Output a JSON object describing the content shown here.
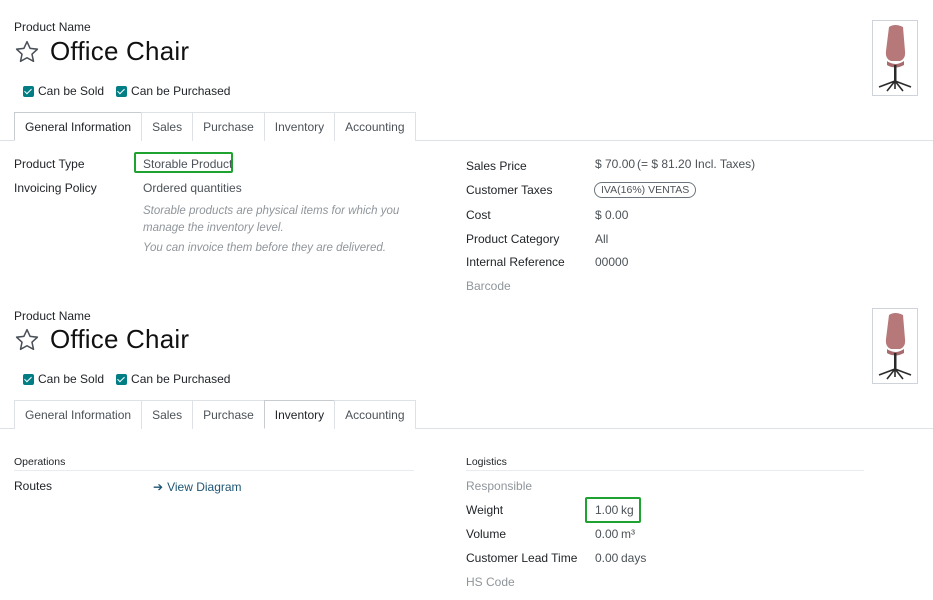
{
  "panels": [
    {
      "product_name_label": "Product Name",
      "title": "Office Chair",
      "checks": [
        "Can be Sold",
        "Can be Purchased"
      ],
      "tabs": [
        "General Information",
        "Sales",
        "Purchase",
        "Inventory",
        "Accounting"
      ],
      "active_tab": "General Information"
    },
    {
      "product_name_label": "Product Name",
      "title": "Office Chair",
      "checks": [
        "Can be Sold",
        "Can be Purchased"
      ],
      "tabs": [
        "General Information",
        "Sales",
        "Purchase",
        "Inventory",
        "Accounting"
      ],
      "active_tab": "Inventory"
    }
  ],
  "general": {
    "product_type_label": "Product Type",
    "product_type_value": "Storable Product",
    "invoicing_policy_label": "Invoicing Policy",
    "invoicing_policy_value": "Ordered quantities",
    "help_line1": "Storable products are physical items for which you",
    "help_line2": "manage the inventory level.",
    "help_line3": "You can invoice them before they are delivered.",
    "sales_price_label": "Sales Price",
    "sales_price_value": "$ 70.00",
    "sales_price_incl": "(= $ 81.20 Incl. Taxes)",
    "customer_taxes_label": "Customer Taxes",
    "customer_taxes_value": "IVA(16%) VENTAS",
    "cost_label": "Cost",
    "cost_value": "$ 0.00",
    "category_label": "Product Category",
    "category_value": "All",
    "internal_ref_label": "Internal Reference",
    "internal_ref_value": "00000",
    "barcode_label": "Barcode"
  },
  "inventory": {
    "operations_title": "Operations",
    "routes_label": "Routes",
    "view_diagram": "View Diagram",
    "logistics_title": "Logistics",
    "responsible_label": "Responsible",
    "weight_label": "Weight",
    "weight_value": "1.00",
    "weight_unit": "kg",
    "volume_label": "Volume",
    "volume_value": "0.00",
    "volume_unit": "m³",
    "lead_time_label": "Customer Lead Time",
    "lead_time_value": "0.00",
    "lead_time_unit": "days",
    "hs_code_label": "HS Code"
  },
  "colors": {
    "checkbox": "#017e84",
    "highlight": "#1fa330",
    "link": "#1e5573"
  }
}
